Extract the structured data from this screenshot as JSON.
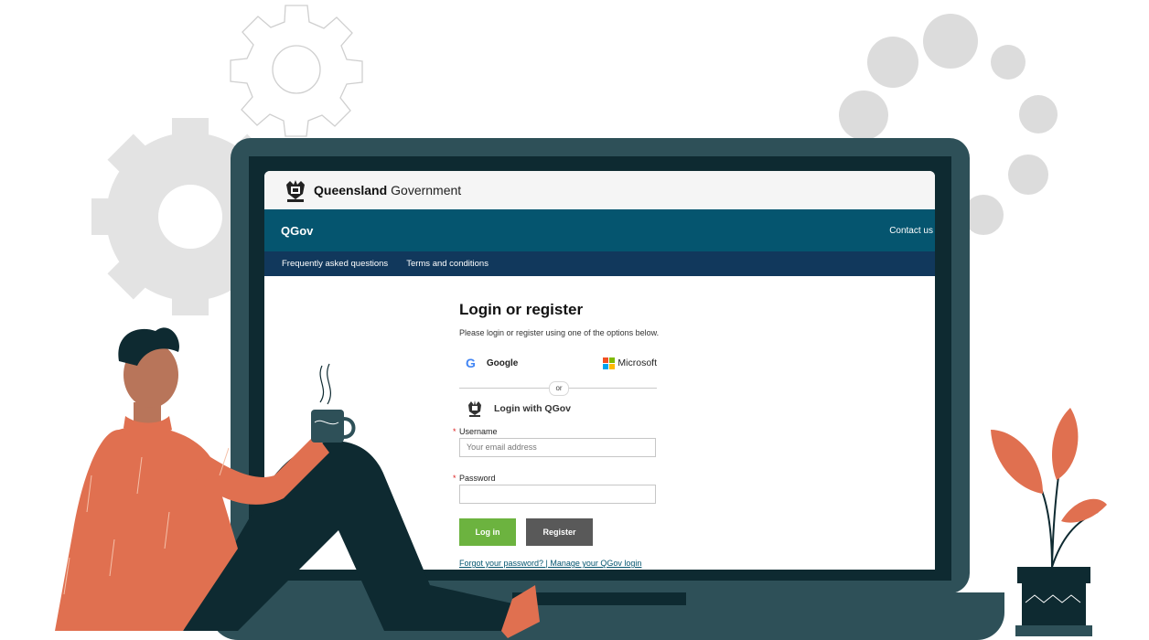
{
  "brand": {
    "bold": "Queensland",
    "light": "Government"
  },
  "bar": {
    "title": "QGov",
    "contact": "Contact us"
  },
  "subnav": {
    "faq": "Frequently asked questions",
    "terms": "Terms and conditions"
  },
  "login": {
    "title": "Login or register",
    "description": "Please login or register using one of the options below.",
    "google_label": "Google",
    "microsoft_label": "Microsoft",
    "or_label": "or",
    "qgov_label": "Login with QGov",
    "username_label": "Username",
    "username_placeholder": "Your email address",
    "password_label": "Password",
    "required_mark": "*",
    "login_button": "Log in",
    "register_button": "Register",
    "links_text": "Forgot your password?  |  Manage your QGov login"
  },
  "colors": {
    "header_bar": "#05556f",
    "subnav": "#11385c",
    "login_button": "#6cb33f",
    "register_button": "#595959",
    "accent_orange": "#e07050",
    "laptop": "#2e5058"
  },
  "icons": {
    "google": "google-g-icon",
    "microsoft": "microsoft-logo-icon",
    "crest": "queensland-crest-icon"
  }
}
